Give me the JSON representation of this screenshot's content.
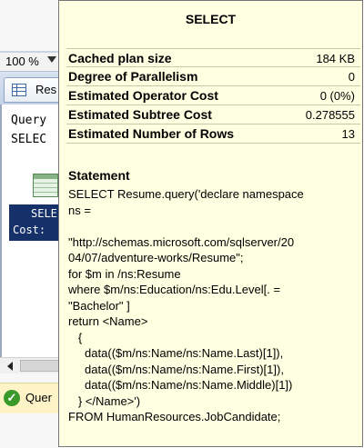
{
  "background": {
    "zoom_level": "100 %",
    "results_tab_label": "Res",
    "plan_lines": [
      "Query",
      "SELEC"
    ],
    "operator_name": "SELE",
    "operator_cost": "Cost:",
    "status_text": "Quer"
  },
  "tooltip": {
    "title": "SELECT",
    "properties": [
      {
        "name": "Cached plan size",
        "value": "184 KB"
      },
      {
        "name": "Degree of Parallelism",
        "value": "0"
      },
      {
        "name": "Estimated Operator Cost",
        "value": "0 (0%)"
      },
      {
        "name": "Estimated Subtree Cost",
        "value": "0.278555"
      },
      {
        "name": "Estimated Number of Rows",
        "value": "13"
      }
    ],
    "statement_heading": "Statement",
    "statement_lines": [
      "SELECT Resume.query('declare namespace",
      "ns =",
      "",
      "\"http://schemas.microsoft.com/sqlserver/20",
      "04/07/adventure-works/Resume\";",
      "for $m in /ns:Resume",
      "where $m/ns:Education/ns:Edu.Level[. =",
      "\"Bachelor\" ]",
      "return <Name>",
      "   {",
      "     data(($m/ns:Name/ns:Name.Last)[1]),",
      "     data(($m/ns:Name/ns:Name.First)[1]),",
      "     data(($m/ns:Name/ns:Name.Middle)[1])",
      "   } </Name>')",
      "FROM HumanResources.JobCandidate;"
    ]
  },
  "colors": {
    "tooltip_background": "#ffffe1",
    "operator_highlight": "#16306a",
    "status_bar": "#fff3c8"
  },
  "icons": [
    "grid-icon",
    "select-operator-icon",
    "success-icon",
    "scroll-left-icon",
    "zoom-dropdown-icon"
  ]
}
